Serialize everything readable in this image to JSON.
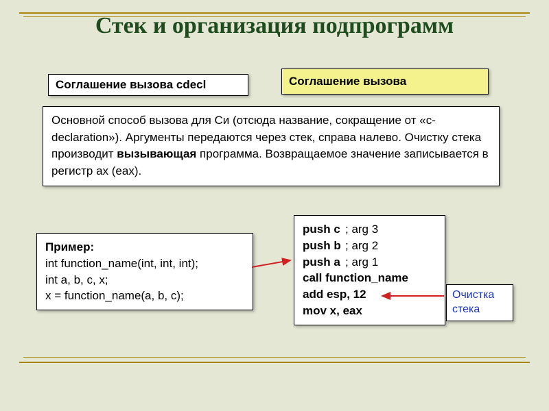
{
  "title": "Стек и организация подпрограмм",
  "header_left": "Соглашение вызова cdecl",
  "header_right": "Соглашение вызова",
  "mainText": {
    "part1": "Основной способ вызова для Си (отсюда название, сокращение от «c-declaration»). Аргументы передаются через стек, справа налево. Очистку стека производит ",
    "bold": "вызывающая",
    "part2": " программа. Возвращаемое значение записывается в регистр ax (eax)."
  },
  "example": {
    "label": "Пример:",
    "line1": "int function_name(int, int, int);",
    "line2": "int a, b, c, x;",
    "line3": "x = function_name(a, b, c);"
  },
  "asm": {
    "rows": [
      {
        "op": "push c",
        "cm": "; arg 3"
      },
      {
        "op": "push b",
        "cm": "; arg 2"
      },
      {
        "op": "push a",
        "cm": "; arg 1"
      },
      {
        "op": "call function_name",
        "cm": ""
      },
      {
        "op": "add esp, 12",
        "cm": ""
      },
      {
        "op": "mov x, eax",
        "cm": ""
      }
    ]
  },
  "cleanup": {
    "line1": "Очистка",
    "line2": "стека"
  }
}
